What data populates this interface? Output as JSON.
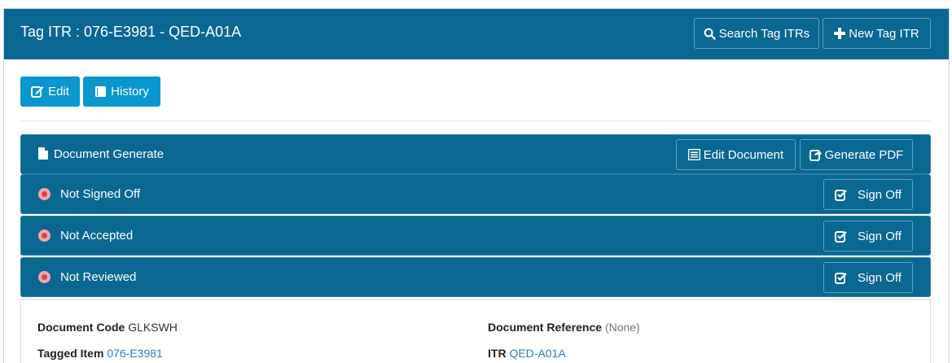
{
  "header": {
    "title": "Tag ITR : 076-E3981 - QED-A01A",
    "search_label": "Search Tag ITRs",
    "new_label": "New Tag ITR"
  },
  "actions": {
    "edit_label": "Edit",
    "history_label": "History"
  },
  "document_panel": {
    "title": "Document Generate",
    "edit_document_label": "Edit Document",
    "generate_pdf_label": "Generate PDF"
  },
  "status_panels": [
    {
      "label": "Not Signed Off",
      "button": "Sign Off"
    },
    {
      "label": "Not Accepted",
      "button": "Sign Off"
    },
    {
      "label": "Not Reviewed",
      "button": "Sign Off"
    }
  ],
  "details": {
    "document_code_label": "Document Code",
    "document_code_value": "GLKSWH",
    "document_reference_label": "Document Reference",
    "document_reference_value": "(None)",
    "tagged_item_label": "Tagged Item",
    "tagged_item_value": "076-E3981",
    "itr_label": "ITR",
    "itr_value": "QED-A01A"
  },
  "colors": {
    "header_bg": "#0a6791",
    "primary_button": "#0a96cf",
    "status_error": "#d9424f",
    "link": "#2a7fb8"
  }
}
